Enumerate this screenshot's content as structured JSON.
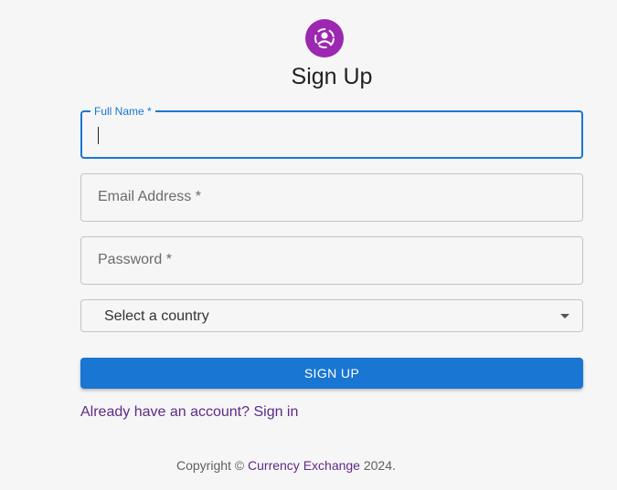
{
  "header": {
    "icon": "person-circle-icon",
    "title": "Sign Up",
    "accent_color": "#9c27b0"
  },
  "form": {
    "full_name": {
      "label": "Full Name *",
      "value": ""
    },
    "email": {
      "placeholder": "Email Address *"
    },
    "password": {
      "placeholder": "Password *"
    },
    "country": {
      "selected": "Select a country"
    },
    "submit_label": "SIGN UP",
    "primary_color": "#1976d2"
  },
  "signin_link": "Already have an account? Sign in",
  "footer": {
    "prefix": "Copyright ©",
    "brand": "Currency Exchange",
    "suffix": "2024."
  }
}
